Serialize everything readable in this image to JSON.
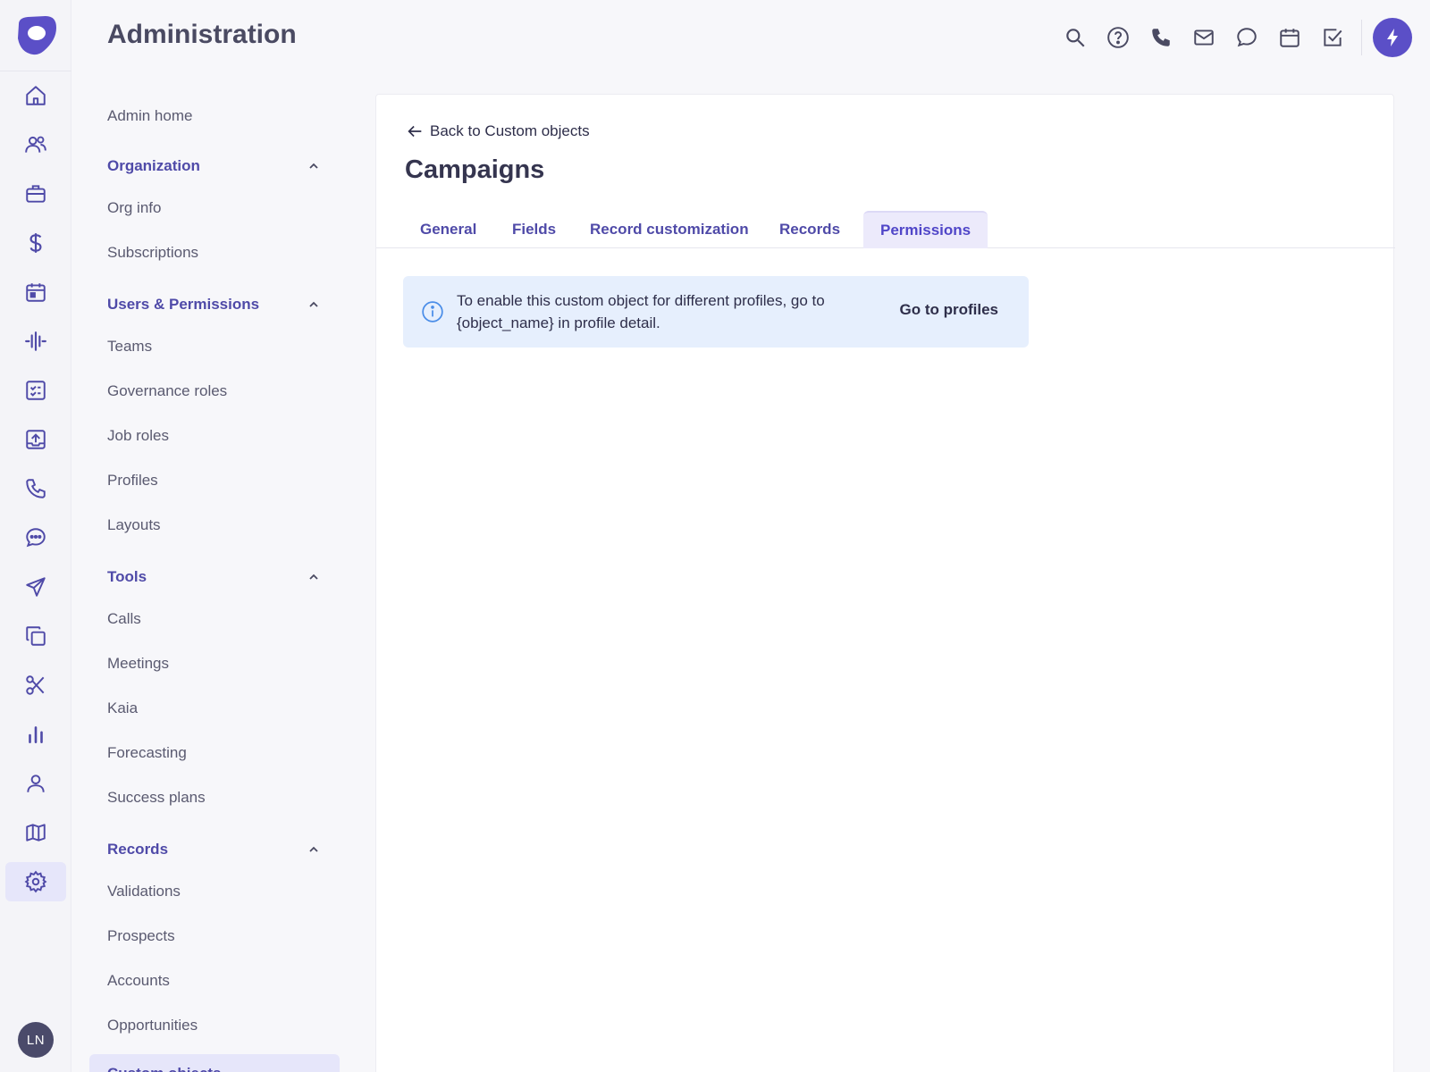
{
  "header": {
    "title": "Administration",
    "icons": [
      "search-icon",
      "help-icon",
      "phone-icon",
      "mail-icon",
      "chat-icon",
      "calendar-icon",
      "task-icon",
      "bolt-icon"
    ]
  },
  "rail": {
    "icons": [
      "home-icon",
      "people-icon",
      "briefcase-icon",
      "dollar-icon",
      "calendar-icon",
      "activity-icon",
      "checklist-icon",
      "upload-icon",
      "phone-icon",
      "chat-icon",
      "send-icon",
      "copy-icon",
      "scissors-icon",
      "bar-chart-icon",
      "person-icon",
      "map-icon",
      "gear-icon"
    ],
    "avatar": "LN",
    "accent": "#5b4fc7"
  },
  "subnav": {
    "admin_home": "Admin home",
    "sections": [
      {
        "title": "Organization",
        "items": [
          "Org info",
          "Subscriptions"
        ]
      },
      {
        "title": "Users & Permissions",
        "items": [
          "Teams",
          "Governance roles",
          "Job roles",
          "Profiles",
          "Layouts"
        ]
      },
      {
        "title": "Tools",
        "items": [
          "Calls",
          "Meetings",
          "Kaia",
          "Forecasting",
          "Success plans"
        ]
      },
      {
        "title": "Records",
        "items": [
          "Validations",
          "Prospects",
          "Accounts",
          "Opportunities",
          "Custom objects"
        ]
      }
    ]
  },
  "main": {
    "back_label": "Back to Custom objects",
    "title": "Campaigns",
    "tabs": [
      "General",
      "Fields",
      "Record customization",
      "Records",
      "Permissions"
    ],
    "active_tab": "Permissions",
    "banner": {
      "line1": "To enable this custom object for different profiles, go to",
      "line2": "{object_name} in profile detail.",
      "action": "Go to profiles"
    }
  }
}
